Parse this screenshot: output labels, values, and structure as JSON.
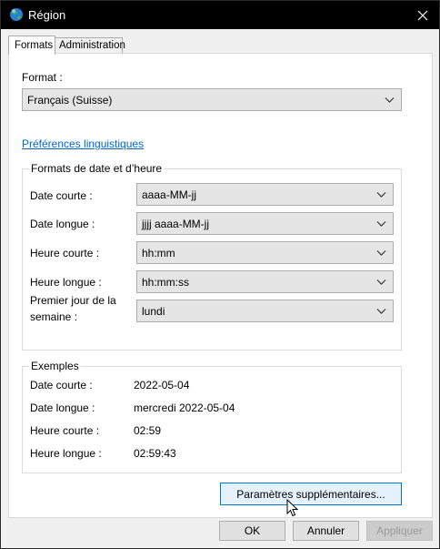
{
  "window": {
    "title": "Région",
    "close_icon": "close-icon",
    "app_icon": "globe-icon"
  },
  "tabs": [
    {
      "label": "Formats",
      "active": true
    },
    {
      "label": "Administration",
      "active": false
    }
  ],
  "format": {
    "label": "Format :",
    "value": "Français (Suisse)"
  },
  "language_link": "Préférences linguistiques",
  "datetime_group": {
    "title": "Formats de date et d’heure",
    "rows": [
      {
        "label": "Date courte :",
        "value": "aaaa-MM-jj"
      },
      {
        "label": "Date longue :",
        "value": "jjjj aaaa-MM-jj"
      },
      {
        "label": "Heure courte :",
        "value": "hh:mm"
      },
      {
        "label": "Heure longue :",
        "value": "hh:mm:ss"
      },
      {
        "label_line1": "Premier jour de la",
        "label_line2": "semaine :",
        "value": "lundi"
      }
    ]
  },
  "examples_group": {
    "title": "Exemples",
    "rows": [
      {
        "label": "Date courte :",
        "value": "2022-05-04"
      },
      {
        "label": "Date longue :",
        "value": "mercredi 2022-05-04"
      },
      {
        "label": "Heure courte :",
        "value": "02:59"
      },
      {
        "label": "Heure longue :",
        "value": "02:59:43"
      }
    ]
  },
  "buttons": {
    "additional": "Paramètres supplémentaires...",
    "ok": "OK",
    "cancel": "Annuler",
    "apply": "Appliquer"
  }
}
